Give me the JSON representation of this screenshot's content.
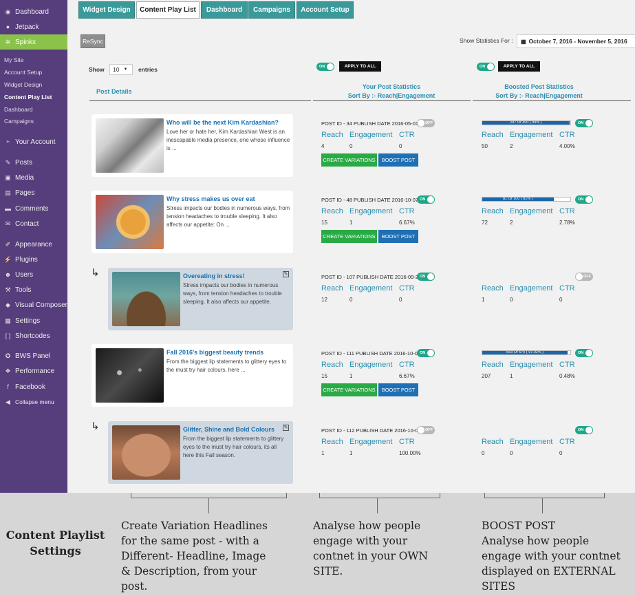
{
  "sidebar": {
    "top": [
      {
        "label": "Dashboard",
        "icon": "dashboard-icon",
        "glyph": "◉"
      },
      {
        "label": "Jetpack",
        "icon": "jetpack-icon",
        "glyph": "●"
      },
      {
        "label": "Spinkx",
        "icon": "spinkx-icon",
        "glyph": "✲"
      }
    ],
    "submenu": [
      "My Site",
      "Account Setup",
      "Widget Design",
      "Content Play List",
      "Dashboard",
      "Campaigns"
    ],
    "bottom": [
      {
        "label": "Your Account",
        "icon": "plus-icon",
        "glyph": "+"
      },
      {
        "label": "Posts",
        "icon": "pin-icon",
        "glyph": "✎"
      },
      {
        "label": "Media",
        "icon": "media-icon",
        "glyph": "▣"
      },
      {
        "label": "Pages",
        "icon": "pages-icon",
        "glyph": "▤"
      },
      {
        "label": "Comments",
        "icon": "comments-icon",
        "glyph": "▬"
      },
      {
        "label": "Contact",
        "icon": "mail-icon",
        "glyph": "✉"
      },
      {
        "label": "Appearance",
        "icon": "brush-icon",
        "glyph": "✐"
      },
      {
        "label": "Plugins",
        "icon": "plug-icon",
        "glyph": "⚡"
      },
      {
        "label": "Users",
        "icon": "users-icon",
        "glyph": "☻"
      },
      {
        "label": "Tools",
        "icon": "wrench-icon",
        "glyph": "⚒"
      },
      {
        "label": "Visual Composer",
        "icon": "vc-icon",
        "glyph": "◆"
      },
      {
        "label": "Settings",
        "icon": "settings-icon",
        "glyph": "▦"
      },
      {
        "label": "Shortcodes",
        "icon": "shortcodes-icon",
        "glyph": "[ ]"
      },
      {
        "label": "BWS Panel",
        "icon": "bws-icon",
        "glyph": "✪"
      },
      {
        "label": "Performance",
        "icon": "performance-icon",
        "glyph": "❖"
      },
      {
        "label": "Facebook",
        "icon": "facebook-icon",
        "glyph": "f"
      },
      {
        "label": "Collapse menu",
        "icon": "collapse-icon",
        "glyph": "◀"
      }
    ]
  },
  "tabs": [
    "Widget Design",
    "Content Play List",
    "Dashboard",
    "Campaigns",
    "Account Setup"
  ],
  "toolbar": {
    "resync": "ReSync",
    "stats_label": "Show Statistics For :",
    "date_range": "October 7, 2016 - November 5, 2016",
    "show": "Show",
    "entries_value": "10",
    "entries": "entries",
    "apply_all": "APPLY TO ALL",
    "toggle_on": "ON",
    "toggle_off": "OFF"
  },
  "headers": {
    "post_details": "Post Details",
    "your_stats": "Your Post Statistics",
    "boosted_stats": "Boosted Post Statistics",
    "sort_by": "Sort By :-",
    "reach": "Reach",
    "sep": "|",
    "engagement": "Engagement"
  },
  "labels": {
    "reach": "Reach",
    "engagement": "Engagement",
    "ctr": "CTR",
    "create_variations": "CREATE VARIATIONS",
    "boost_post": "BOOST POST",
    "edit_glyph": "✎",
    "arrow_glyph": "↳"
  },
  "posts": [
    {
      "title": "Who will be the next Kim Kardashian?",
      "desc": "Love her or hate her, Kim Kardashian West is an inescapable media presence, one whose influence is ...",
      "meta": "POST ID - 34   PUBLISH DATE 2016-05-01",
      "own_toggle": "OFF",
      "own": {
        "reach": "4",
        "engagement": "0",
        "ctr": "0"
      },
      "boost_label": "297 Of 300 ( 99% )",
      "boost_pct": 0.99,
      "boost_toggle": "ON",
      "boost": {
        "reach": "50",
        "engagement": "2",
        "ctr": "4.00%"
      },
      "variation": false,
      "buttons": true
    },
    {
      "title": "Why stress makes us over eat",
      "desc": "Stress impacts our bodies in numerous ways, from tension headaches to trouble sleeping. It also affects our appetite: On ...",
      "meta": "POST ID - 48   PUBLISH DATE 2016-10-07",
      "own_toggle": "ON",
      "own": {
        "reach": "15",
        "engagement": "1",
        "ctr": "6.67%"
      },
      "boost_label": "81 Of 100 ( 81% )",
      "boost_pct": 0.81,
      "boost_toggle": "ON",
      "boost": {
        "reach": "72",
        "engagement": "2",
        "ctr": "2.78%"
      },
      "variation": false,
      "buttons": true
    },
    {
      "title": "Overeating in stress!",
      "desc": "Stress impacts our bodies in numerous ways, from tension headaches to trouble sleeping. It also affects our appetite.",
      "meta": "POST ID - 107   PUBLISH DATE 2016-09-23",
      "own_toggle": "ON",
      "own": {
        "reach": "12",
        "engagement": "0",
        "ctr": "0"
      },
      "boost_label": "",
      "boost_pct": null,
      "boost_toggle": "OFF",
      "boost": {
        "reach": "1",
        "engagement": "0",
        "ctr": "0"
      },
      "variation": true,
      "buttons": false
    },
    {
      "title": "Fall 2016's biggest beauty trends",
      "desc": "From the biggest lip statements to glittery eyes to the must try hair colours, here ...",
      "meta": "POST ID - 111   PUBLISH DATE 2016-10-04",
      "own_toggle": "ON",
      "own": {
        "reach": "15",
        "engagement": "1",
        "ctr": "6.67%"
      },
      "boost_label": "553 Of 570 ( 97.02% )",
      "boost_pct": 0.9702,
      "boost_toggle": "ON",
      "boost": {
        "reach": "207",
        "engagement": "1",
        "ctr": "0.48%"
      },
      "variation": false,
      "buttons": true
    },
    {
      "title": "Glitter, Shine and Bold Colours",
      "desc": "From the biggest lip statements to glittery eyes to the must try hair colours, its all here this Fall season.",
      "meta": "POST ID - 112   PUBLISH DATE 2016-10-07",
      "own_toggle": "OFF",
      "own": {
        "reach": "1",
        "engagement": "1",
        "ctr": "100.00%"
      },
      "boost_label": "",
      "boost_pct": null,
      "boost_toggle": "ON",
      "boost": {
        "reach": "0",
        "engagement": "0",
        "ctr": "0"
      },
      "variation": true,
      "buttons": false
    }
  ],
  "annotations": {
    "settings_title": "Content Playlist Settings",
    "left": "Create Variation Headlines for the same post - with a Different- Headline, Image & Description, from your post.",
    "middle": "Analyse how people engage with your contnet in your OWN SITE.",
    "right_title": "BOOST POST",
    "right": "Analyse how people engage with your contnet displayed on EXTERNAL SITES"
  },
  "colors": {
    "sidebar": "#563d7c",
    "active_menu": "#8bc34a",
    "tab": "#3a9a9a",
    "link": "#2a8fb0",
    "green": "#2aaa45",
    "blue": "#1e6fb3",
    "toggle_on": "#1fa789"
  }
}
